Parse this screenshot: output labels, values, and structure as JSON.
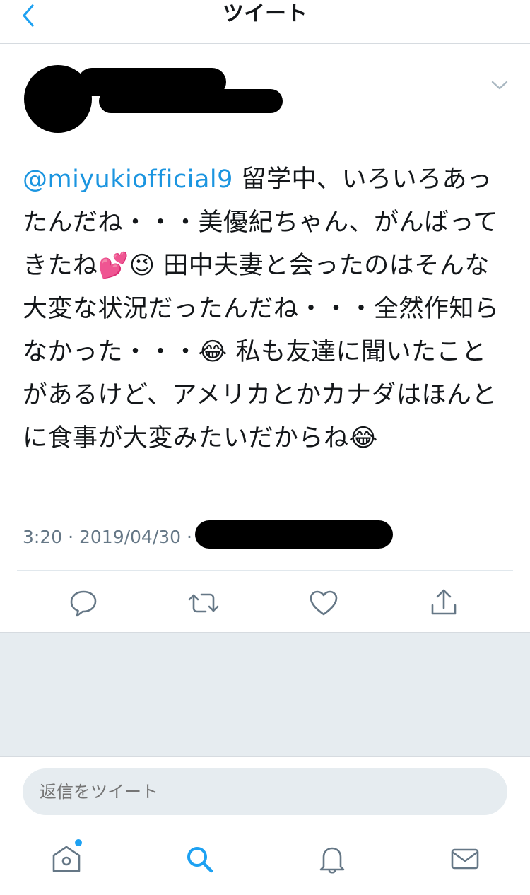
{
  "header": {
    "title": "ツイート"
  },
  "tweet": {
    "mention": "@miyukiofficial9",
    "text": " 留学中、いろいろあったんだね・・・美優紀ちゃん、がんばってきたね💕😉 田中夫妻と会ったのはそんな大変な状況だったんだね・・・全然作知らなかった・・・😂 私も友達に聞いたことがあるけど、アメリカとかカナダはほんとに食事が大変みたいだからね😂",
    "meta": "3:20 · 2019/04/30 ·"
  },
  "reply": {
    "placeholder": "返信をツイート"
  },
  "icons": {
    "back": "chevron-left-icon",
    "caret": "chevron-down-icon",
    "reply": "reply-icon",
    "retweet": "retweet-icon",
    "like": "heart-icon",
    "share": "share-icon",
    "home": "home-icon",
    "search": "search-icon",
    "notifications": "bell-icon",
    "messages": "envelope-icon"
  },
  "colors": {
    "accent": "#1da1f2",
    "mention": "#1b95e0",
    "icon_gray": "#657786"
  }
}
